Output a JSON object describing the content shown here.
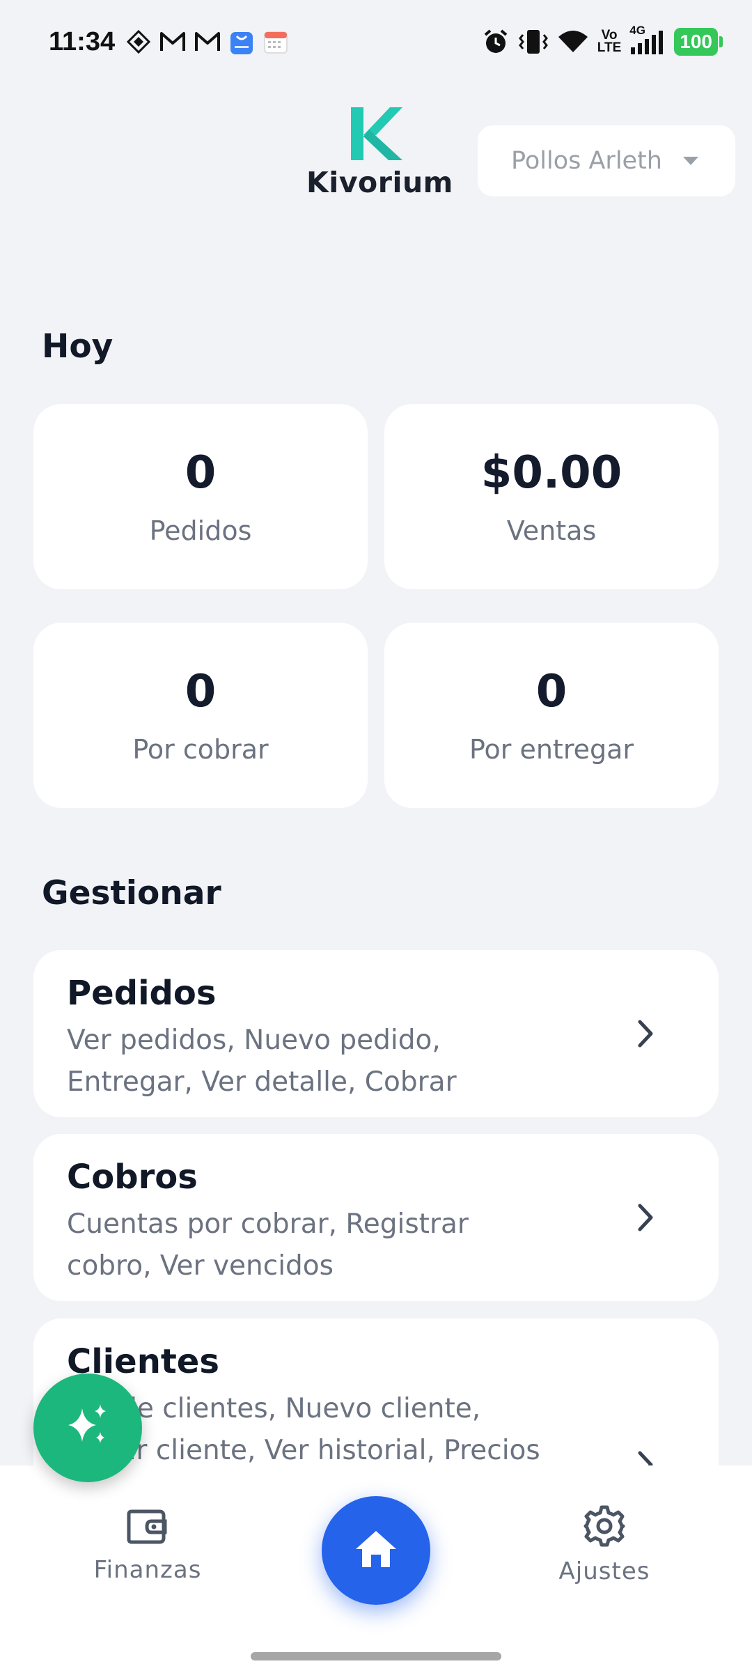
{
  "status_bar": {
    "time": "11:34",
    "battery": "100",
    "icons_left": [
      "diamond-icon",
      "gmail-icon",
      "gmail-icon",
      "bag-icon",
      "calendar-icon"
    ],
    "icons_right": [
      "alarm-icon",
      "vibrate-icon",
      "wifi-icon",
      "volte-icon",
      "signal-icon"
    ],
    "volte_top": "Vo",
    "volte_bottom": "LTE",
    "net": "4G"
  },
  "header": {
    "app_name": "Kivorium",
    "business_selector": "Pollos Arleth"
  },
  "today": {
    "title": "Hoy",
    "stats": [
      {
        "value": "0",
        "label": "Pedidos"
      },
      {
        "value": "$0.00",
        "label": "Ventas"
      },
      {
        "value": "0",
        "label": "Por cobrar"
      },
      {
        "value": "0",
        "label": "Por entregar"
      }
    ]
  },
  "manage": {
    "title": "Gestionar",
    "items": [
      {
        "title": "Pedidos",
        "description": "Ver pedidos, Nuevo pedido, Entregar, Ver detalle, Cobrar"
      },
      {
        "title": "Cobros",
        "description": "Cuentas por cobrar, Registrar cobro, Ver vencidos"
      },
      {
        "title": "Clientes",
        "description": "Ver de clientes, Nuevo cliente, Editar cliente, Ver historial, Precios"
      }
    ]
  },
  "bottom_nav": {
    "finanzas": "Finanzas",
    "ajustes": "Ajustes"
  },
  "colors": {
    "accent_teal": "#22c9b3",
    "fab_green": "#1cb77c",
    "home_blue": "#2563eb",
    "battery_green": "#34c759"
  }
}
